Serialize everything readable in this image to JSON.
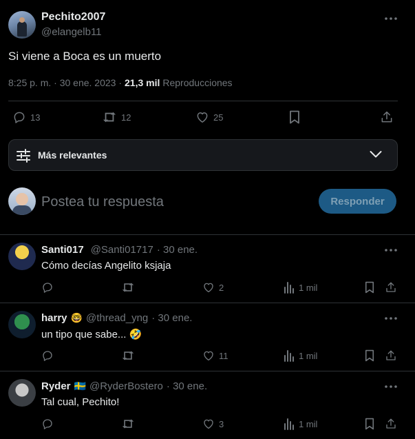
{
  "tweet": {
    "author_name": "Pechito2007",
    "author_handle": "@elangelb11",
    "text": "Si viene a Boca es un muerto",
    "timestamp": "8:25 p. m. · 30 ene. 2023 ·",
    "views_count": "21,3 mil",
    "views_label": "Reproducciones",
    "stats": {
      "replies": "13",
      "retweets": "12",
      "likes": "25"
    }
  },
  "sort": {
    "label": "Más relevantes"
  },
  "compose": {
    "placeholder": "Postea tu respuesta",
    "button_label": "Responder"
  },
  "replies": [
    {
      "name": "Santi017",
      "handle": "@Santi01717",
      "date": "· 30 ene.",
      "emoji": "",
      "text": "Cómo decías Angelito ksjaja",
      "replies": "",
      "retweets": "",
      "likes": "2",
      "views": "1 mil"
    },
    {
      "name": "harry",
      "handle": "@thread_yng",
      "date": "· 30 ene.",
      "emoji": "🤓",
      "text": "un tipo que sabe... 🤣",
      "replies": "",
      "retweets": "",
      "likes": "11",
      "views": "1 mil"
    },
    {
      "name": "Ryder",
      "handle": "@RyderBostero",
      "date": "· 30 ene.",
      "emoji": "🇸🇪",
      "text": "Tal cual, Pechito!",
      "replies": "",
      "retweets": "",
      "likes": "3",
      "views": "1 mil"
    }
  ],
  "colors": {
    "background": "#000000",
    "text": "#e7e9ea",
    "muted": "#71767b",
    "accent_button": "#1d5a85",
    "accent_button_text": "#7e9fb4",
    "sort_bg": "#16181c",
    "divider": "#2f3336"
  }
}
